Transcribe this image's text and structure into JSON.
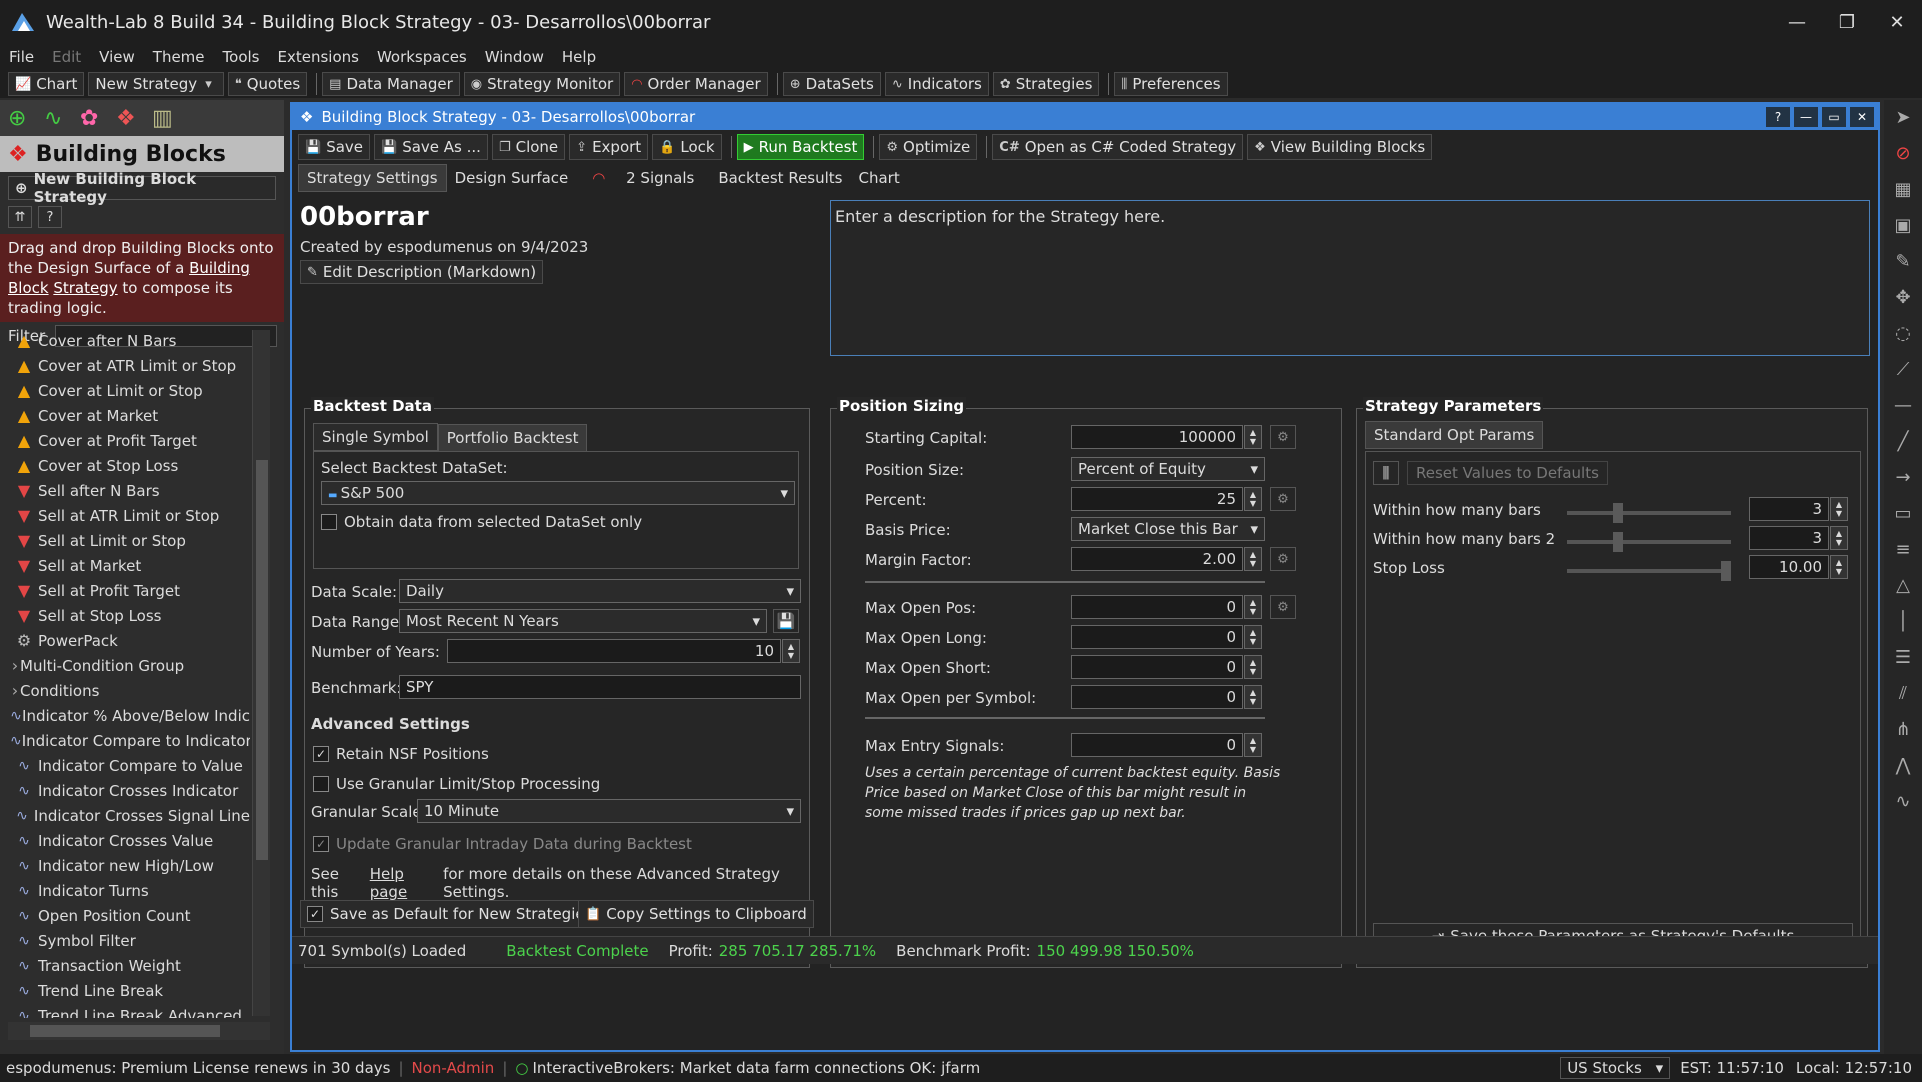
{
  "window": {
    "title": "Wealth-Lab 8 Build 34 - Building Block Strategy - 03- Desarrollos\\00borrar"
  },
  "menu": [
    "File",
    "Edit",
    "View",
    "Theme",
    "Tools",
    "Extensions",
    "Workspaces",
    "Window",
    "Help"
  ],
  "toolbar": {
    "chart": "Chart",
    "new_strategy": "New Strategy",
    "quotes": "Quotes",
    "data_manager": "Data Manager",
    "strategy_monitor": "Strategy Monitor",
    "order_manager": "Order Manager",
    "datasets": "DataSets",
    "indicators": "Indicators",
    "strategies": "Strategies",
    "preferences": "Preferences"
  },
  "left": {
    "title": "Building Blocks",
    "new_button": "New Building Block Strategy",
    "info_pre": "Drag and drop Building Blocks onto the Design Surface of a",
    "info_link1": "Building Block",
    "info_link2": "Strategy",
    "info_post": "to compose its trading logic.",
    "filter_label": "Filter",
    "items": [
      {
        "icon": "tri",
        "label": "Cover after N Bars"
      },
      {
        "icon": "tri",
        "label": "Cover at ATR Limit or Stop"
      },
      {
        "icon": "tri",
        "label": "Cover at Limit or Stop"
      },
      {
        "icon": "tri",
        "label": "Cover at Market"
      },
      {
        "icon": "tri",
        "label": "Cover at Profit Target"
      },
      {
        "icon": "tri",
        "label": "Cover at Stop Loss"
      },
      {
        "icon": "down",
        "label": "Sell after N Bars"
      },
      {
        "icon": "down",
        "label": "Sell at ATR Limit or Stop"
      },
      {
        "icon": "down",
        "label": "Sell at Limit or Stop"
      },
      {
        "icon": "down",
        "label": "Sell at Market"
      },
      {
        "icon": "down",
        "label": "Sell at Profit Target"
      },
      {
        "icon": "down",
        "label": "Sell at Stop Loss"
      },
      {
        "icon": "gear",
        "label": "PowerPack"
      },
      {
        "icon": "group",
        "label": "Multi-Condition Group"
      },
      {
        "icon": "group",
        "label": "Conditions"
      },
      {
        "icon": "wave",
        "label": "Indicator % Above/Below Indic"
      },
      {
        "icon": "wave",
        "label": "Indicator Compare to Indicator"
      },
      {
        "icon": "wave",
        "label": "Indicator Compare to Value"
      },
      {
        "icon": "wave",
        "label": "Indicator Crosses Indicator"
      },
      {
        "icon": "wave",
        "label": "Indicator Crosses Signal Line"
      },
      {
        "icon": "wave",
        "label": "Indicator Crosses Value"
      },
      {
        "icon": "wave",
        "label": "Indicator new High/Low"
      },
      {
        "icon": "wave",
        "label": "Indicator Turns"
      },
      {
        "icon": "wave",
        "label": "Open Position Count"
      },
      {
        "icon": "wave",
        "label": "Symbol Filter"
      },
      {
        "icon": "wave",
        "label": "Transaction Weight"
      },
      {
        "icon": "wave",
        "label": "Trend Line Break"
      },
      {
        "icon": "wave",
        "label": "Trend Line Break Advanced"
      }
    ]
  },
  "doc": {
    "title": "Building Block Strategy - 03- Desarrollos\\00borrar",
    "tools": {
      "save": "Save",
      "save_as": "Save As ...",
      "clone": "Clone",
      "export": "Export",
      "lock": "Lock",
      "run": "Run Backtest",
      "optimize": "Optimize",
      "open_cs": "Open as C# Coded Strategy",
      "view_blocks": "View Building Blocks"
    },
    "tabs": [
      "Strategy Settings",
      "Design Surface",
      "2 Signals",
      "Backtest Results",
      "Chart"
    ],
    "name": "00borrar",
    "created": "Created by espodumenus on 9/4/2023",
    "edit_desc": "Edit Description (Markdown)",
    "description": "Enter a description for the Strategy here."
  },
  "backtest": {
    "title": "Backtest Data",
    "tab1": "Single Symbol",
    "tab2": "Portfolio Backtest",
    "dataset_label": "Select Backtest DataSet:",
    "dataset": "S&P 500",
    "obtain": "Obtain data from selected DataSet only",
    "scale_label": "Data Scale:",
    "scale": "Daily",
    "range_label": "Data Range:",
    "range": "Most Recent N Years",
    "years_label": "Number of Years:",
    "years": "10",
    "bench_label": "Benchmark:",
    "bench": "SPY",
    "adv_title": "Advanced Settings",
    "retain": "Retain NSF Positions",
    "granular": "Use Granular Limit/Stop Processing",
    "gscale_label": "Granular Scale",
    "gscale": "10 Minute",
    "update": "Update Granular Intraday Data during Backtest",
    "help_pre": "See this",
    "help_link": "Help page",
    "help_post": "for more details on these Advanced Strategy Settings."
  },
  "position": {
    "title": "Position Sizing",
    "capital_label": "Starting Capital:",
    "capital": "100000",
    "size_label": "Position Size:",
    "size": "Percent of Equity",
    "percent_label": "Percent:",
    "percent": "25",
    "basis_label": "Basis Price:",
    "basis": "Market Close this Bar",
    "margin_label": "Margin Factor:",
    "margin": "2.00",
    "maxpos_label": "Max Open Pos:",
    "maxpos": "0",
    "maxlong_label": "Max Open Long:",
    "maxlong": "0",
    "maxshort_label": "Max Open Short:",
    "maxshort": "0",
    "maxsym_label": "Max Open per Symbol:",
    "maxsym": "0",
    "maxentry_label": "Max Entry Signals:",
    "maxentry": "0",
    "note": "Uses a certain percentage of current backtest equity. Basis Price based on Market Close of this bar might result in some missed trades if prices gap up next bar."
  },
  "params": {
    "title": "Strategy Parameters",
    "tab": "Standard Opt Params",
    "reset": "Reset Values to Defaults",
    "items": [
      {
        "label": "Within how many bars",
        "value": "3",
        "level": 0.3
      },
      {
        "label": "Within how many bars 2",
        "value": "3",
        "level": 0.3
      },
      {
        "label": "Stop Loss",
        "value": "10.00",
        "level": 1.0
      }
    ],
    "save": "Save these Parameters as Strategy's Defaults"
  },
  "bottom_buttons": {
    "save_default": "Save as Default for New Strategies",
    "copy": "Copy Settings to Clipboard"
  },
  "status": {
    "loaded": "701 Symbol(s) Loaded",
    "complete": "Backtest Complete",
    "profit_label": "Profit:",
    "profit": "285 705.17 285.71%",
    "bench_label": "Benchmark Profit:",
    "bench": "150 499.98 150.50%"
  },
  "footer": {
    "license": "espodumenus: Premium License renews in 30 days",
    "admin": "Non-Admin",
    "ib": "InteractiveBrokers: Market data farm connections OK: jfarm",
    "market": "US Stocks",
    "est": "EST: 11:57:10",
    "local": "Local: 12:57:10"
  },
  "colors": {
    "accent": "#3a7fd4",
    "run": "#1f7a1f",
    "profit": "#4cd34c",
    "warn": "#e34a4a"
  }
}
